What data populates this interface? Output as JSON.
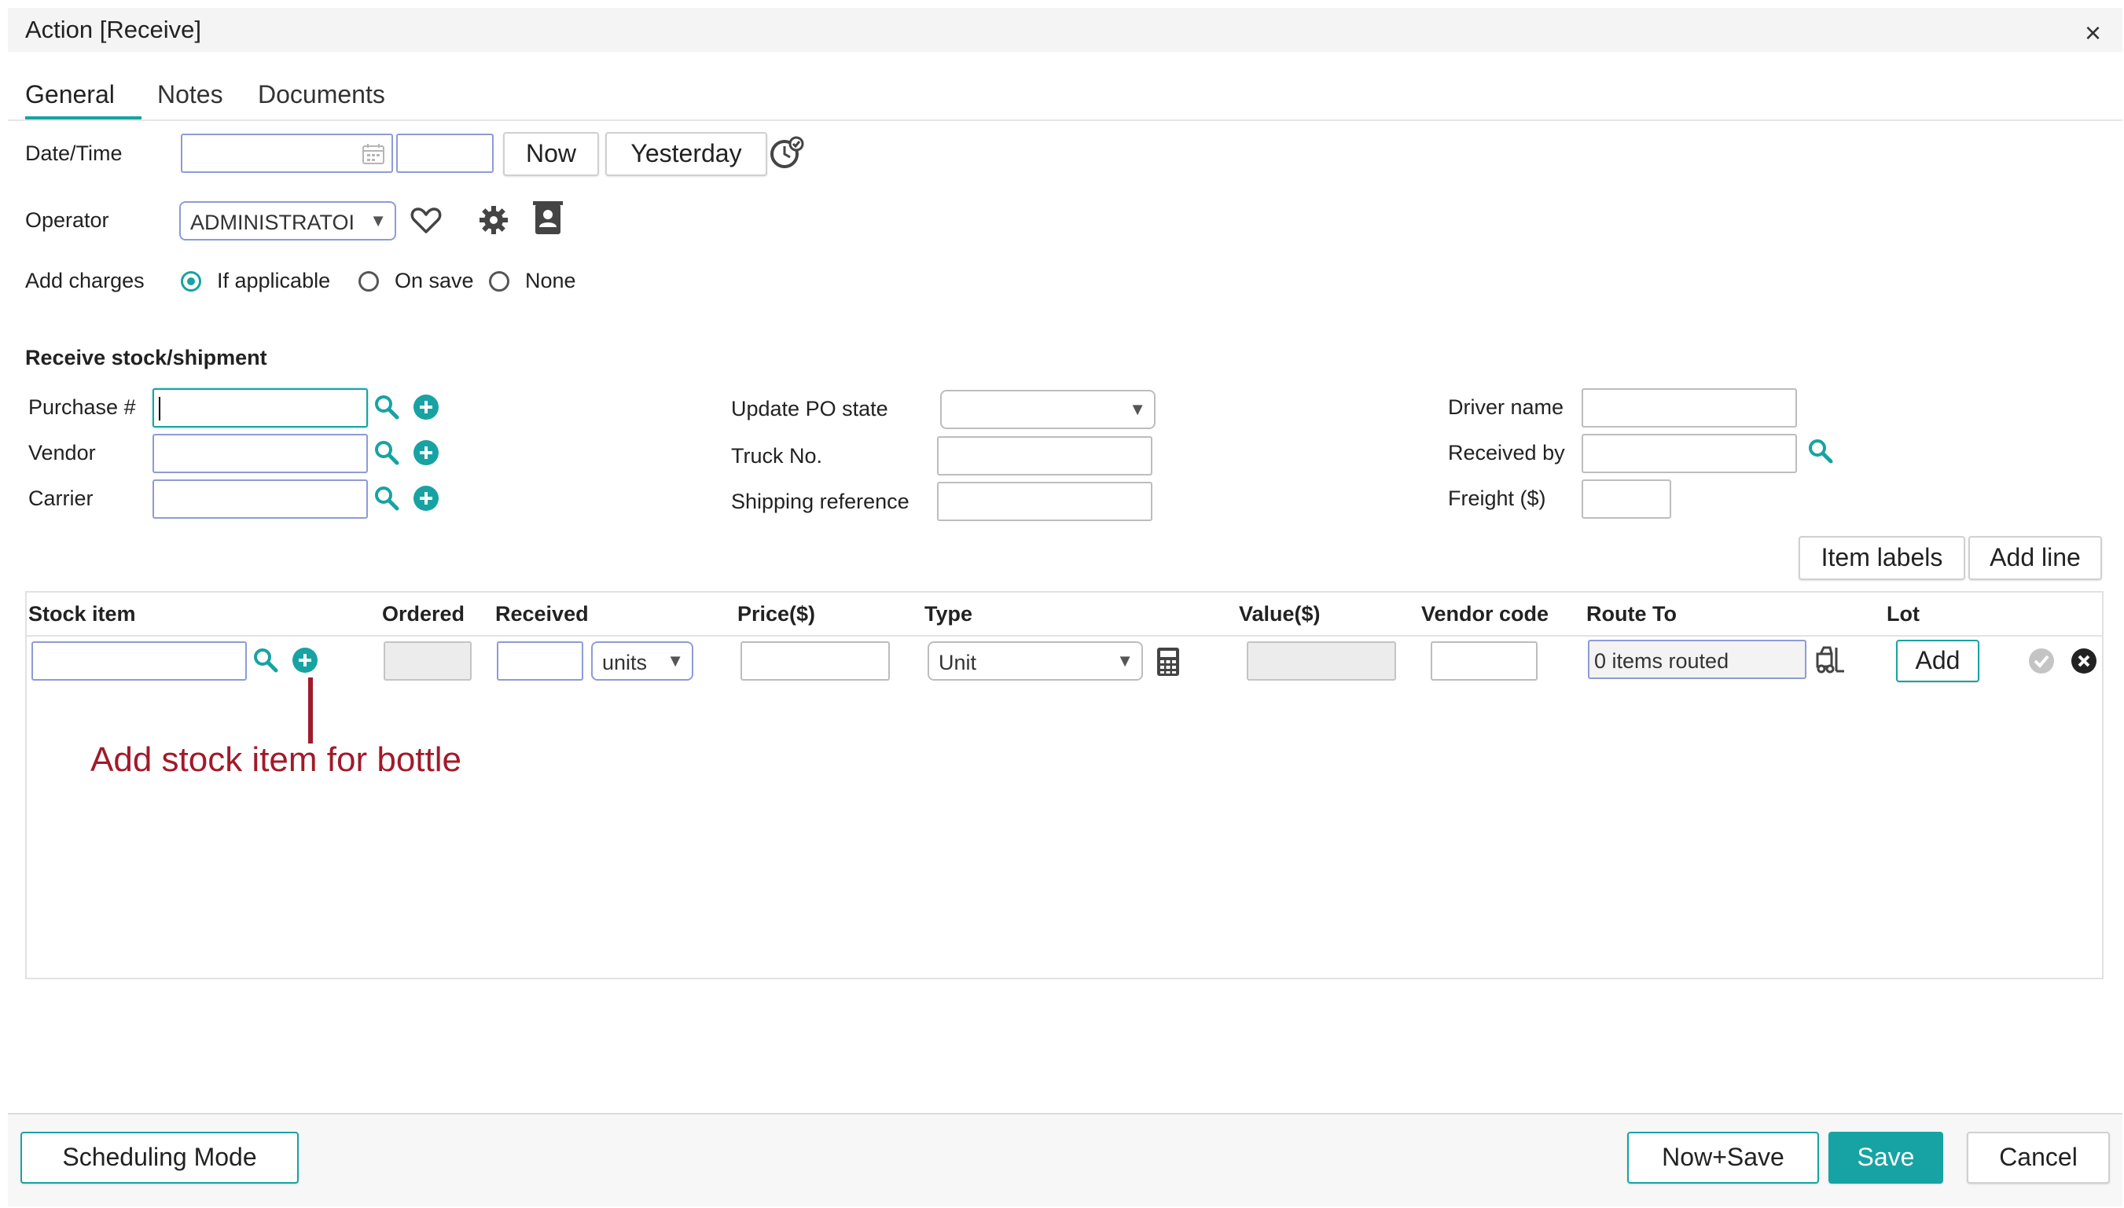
{
  "window": {
    "title": "Action [Receive]",
    "close_label": "×"
  },
  "tabs": [
    {
      "label": "General",
      "active": true
    },
    {
      "label": "Notes",
      "active": false
    },
    {
      "label": "Documents",
      "active": false
    }
  ],
  "datetime": {
    "label": "Date/Time",
    "date_value": "",
    "time_value": "",
    "now_label": "Now",
    "yesterday_label": "Yesterday"
  },
  "operator": {
    "label": "Operator",
    "value": "ADMINISTRATOI"
  },
  "charges": {
    "label": "Add charges",
    "options": [
      {
        "label": "If applicable",
        "selected": true
      },
      {
        "label": "On save",
        "selected": false
      },
      {
        "label": "None",
        "selected": false
      }
    ]
  },
  "receive": {
    "section_title": "Receive stock/shipment",
    "purchase_label": "Purchase #",
    "vendor_label": "Vendor",
    "carrier_label": "Carrier",
    "update_po_label": "Update PO state",
    "truck_label": "Truck No.",
    "shipping_label": "Shipping reference",
    "driver_label": "Driver name",
    "received_by_label": "Received by",
    "freight_label": "Freight ($)"
  },
  "grid": {
    "item_labels_button": "Item labels",
    "add_line_button": "Add line",
    "columns": [
      "Stock item",
      "Ordered",
      "Received",
      "Price($)",
      "Type",
      "Value($)",
      "Vendor code",
      "Route To",
      "Lot"
    ],
    "row": {
      "units": "units",
      "type": "Unit",
      "route_value": "0 items routed",
      "lot_add": "Add"
    }
  },
  "annotation": {
    "text": "Add stock item for bottle",
    "color": "#a11a2a"
  },
  "footer": {
    "scheduling": "Scheduling Mode",
    "now_save": "Now+Save",
    "save": "Save",
    "cancel": "Cancel"
  },
  "colors": {
    "accent": "#17a3a3",
    "input_border": "#8e9bd6"
  },
  "icons": [
    "calendar-icon",
    "clock-check-icon",
    "heart-icon",
    "gear-icon",
    "contact-card-icon",
    "search-icon",
    "add-circle-icon",
    "calculator-icon",
    "forklift-icon",
    "check-circle-icon",
    "remove-circle-icon"
  ]
}
